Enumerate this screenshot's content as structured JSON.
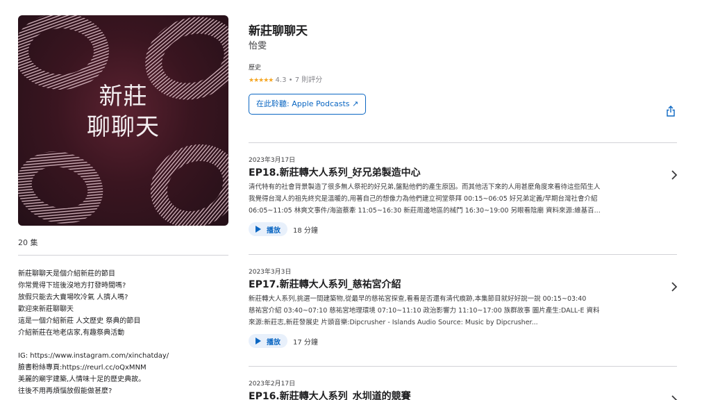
{
  "artwork": {
    "title_line1": "新莊",
    "title_line2": "聊聊天"
  },
  "episode_count": "20 集",
  "description": {
    "lines": [
      "新莊聊聊天是個介紹新莊的節目",
      "你常覺得下班後沒地方打發時間嗎?",
      "放假只能去大賣場吹冷氣 人擠人嗎?",
      "歡迎來新莊聊聊天",
      "這是一個介紹新莊 人文歷史 祭典的節目",
      "介紹新莊在地老店家,有趣祭典活動"
    ],
    "lines2": [
      "IG: https://www.instagram.com/xinchatday/",
      "臉書粉絲專頁:https://reurl.cc/oQxMNM",
      "美麗的廟宇建築,人情味十足的歷史典故。",
      "往後不用再煩惱放假能做甚麼?"
    ]
  },
  "show": {
    "title": "新莊聊聊天",
    "author": "怡雯",
    "genre": "歷史",
    "stars": "★★★★★",
    "rating_text": "4.3 • 7 則評分",
    "listen_button": "在此聆聽: Apple Podcasts ↗"
  },
  "episodes": [
    {
      "date": "2023年3月17日",
      "title": "EP18.新莊轉大人系列_好兄弟製造中心",
      "desc": [
        "清代特有的社會背景製造了很多無人祭祀的好兄弟,盤點他們的產生原因。而其他活下來的人用甚麼角度來看待這些陌生人",
        "我覺得台灣人的祖先終究是溫暖的,用著自己的想像力為他們建立祠堂祭拜 00:15~06:05 好兄弟定義/早期台灣社會介紹",
        "06:05~11:05 林爽文事件/海盜蔡牽 11:05~16:30 新莊周邊地區的械鬥 16:30~19:00 另眼看陰廟 資料來源:維基百..."
      ],
      "play_label": "播放",
      "duration": "18 分鐘"
    },
    {
      "date": "2023年3月3日",
      "title": "EP17.新莊轉大人系列_慈祐宮介紹",
      "desc": [
        "新莊轉大人系列,挑選一間建築物,從最早的慈祐宮探查,看看是否還有清代痕跡,本集節目就好好說一說 00:15~03:40",
        "慈祐宮介紹 03:40~07:10 慈祐宮地理環境 07:10~11:10 政治影響力 11:10~17:00 族群故事 圖片產生:DALL-E 資料",
        "來源:新莊志,新莊發展史 片頭音樂:Dipcrusher - Islands Audio Source: Music by Dipcrusher..."
      ],
      "play_label": "播放",
      "duration": "17 分鐘"
    },
    {
      "date": "2023年2月17日",
      "title": "EP16.新莊轉大人系列_水圳道的競賽"
    }
  ],
  "colors": {
    "accent": "#0a66c2",
    "star": "#f5a623",
    "artwork_bg": "#3a1520"
  }
}
